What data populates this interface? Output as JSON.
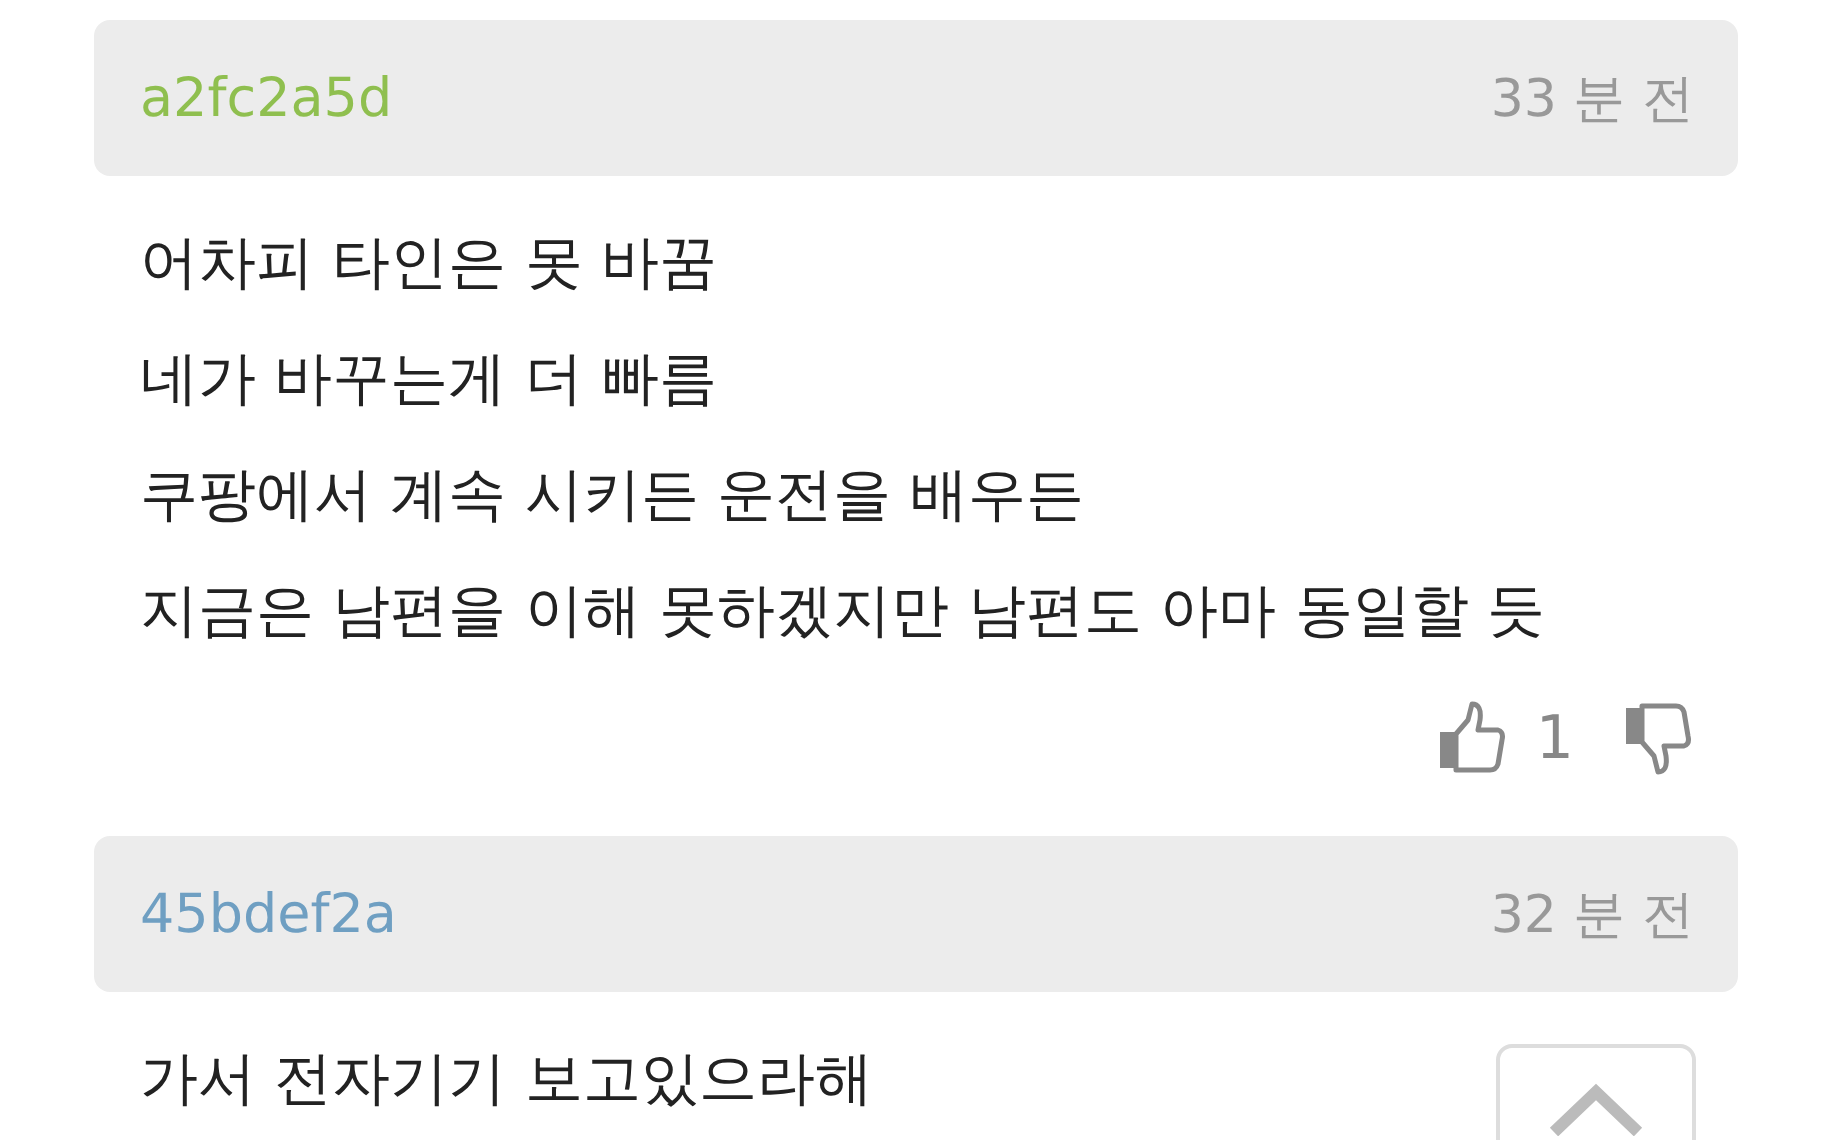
{
  "comments": [
    {
      "author": "a2fc2a5d",
      "color": "#8fbf4f",
      "time": "33 분 전",
      "lines": [
        "어차피 타인은 못 바꿈",
        "네가 바꾸는게 더 빠름",
        "쿠팡에서 계속 시키든 운전을 배우든",
        "지금은 남편을 이해 못하겠지만 남편도 아마 동일할 듯"
      ],
      "likes": "1"
    },
    {
      "author": "45bdef2a",
      "color": "#6f9fc2",
      "time": "32 분 전",
      "lines": [
        "가서 전자기기 보고있으라해"
      ]
    }
  ]
}
